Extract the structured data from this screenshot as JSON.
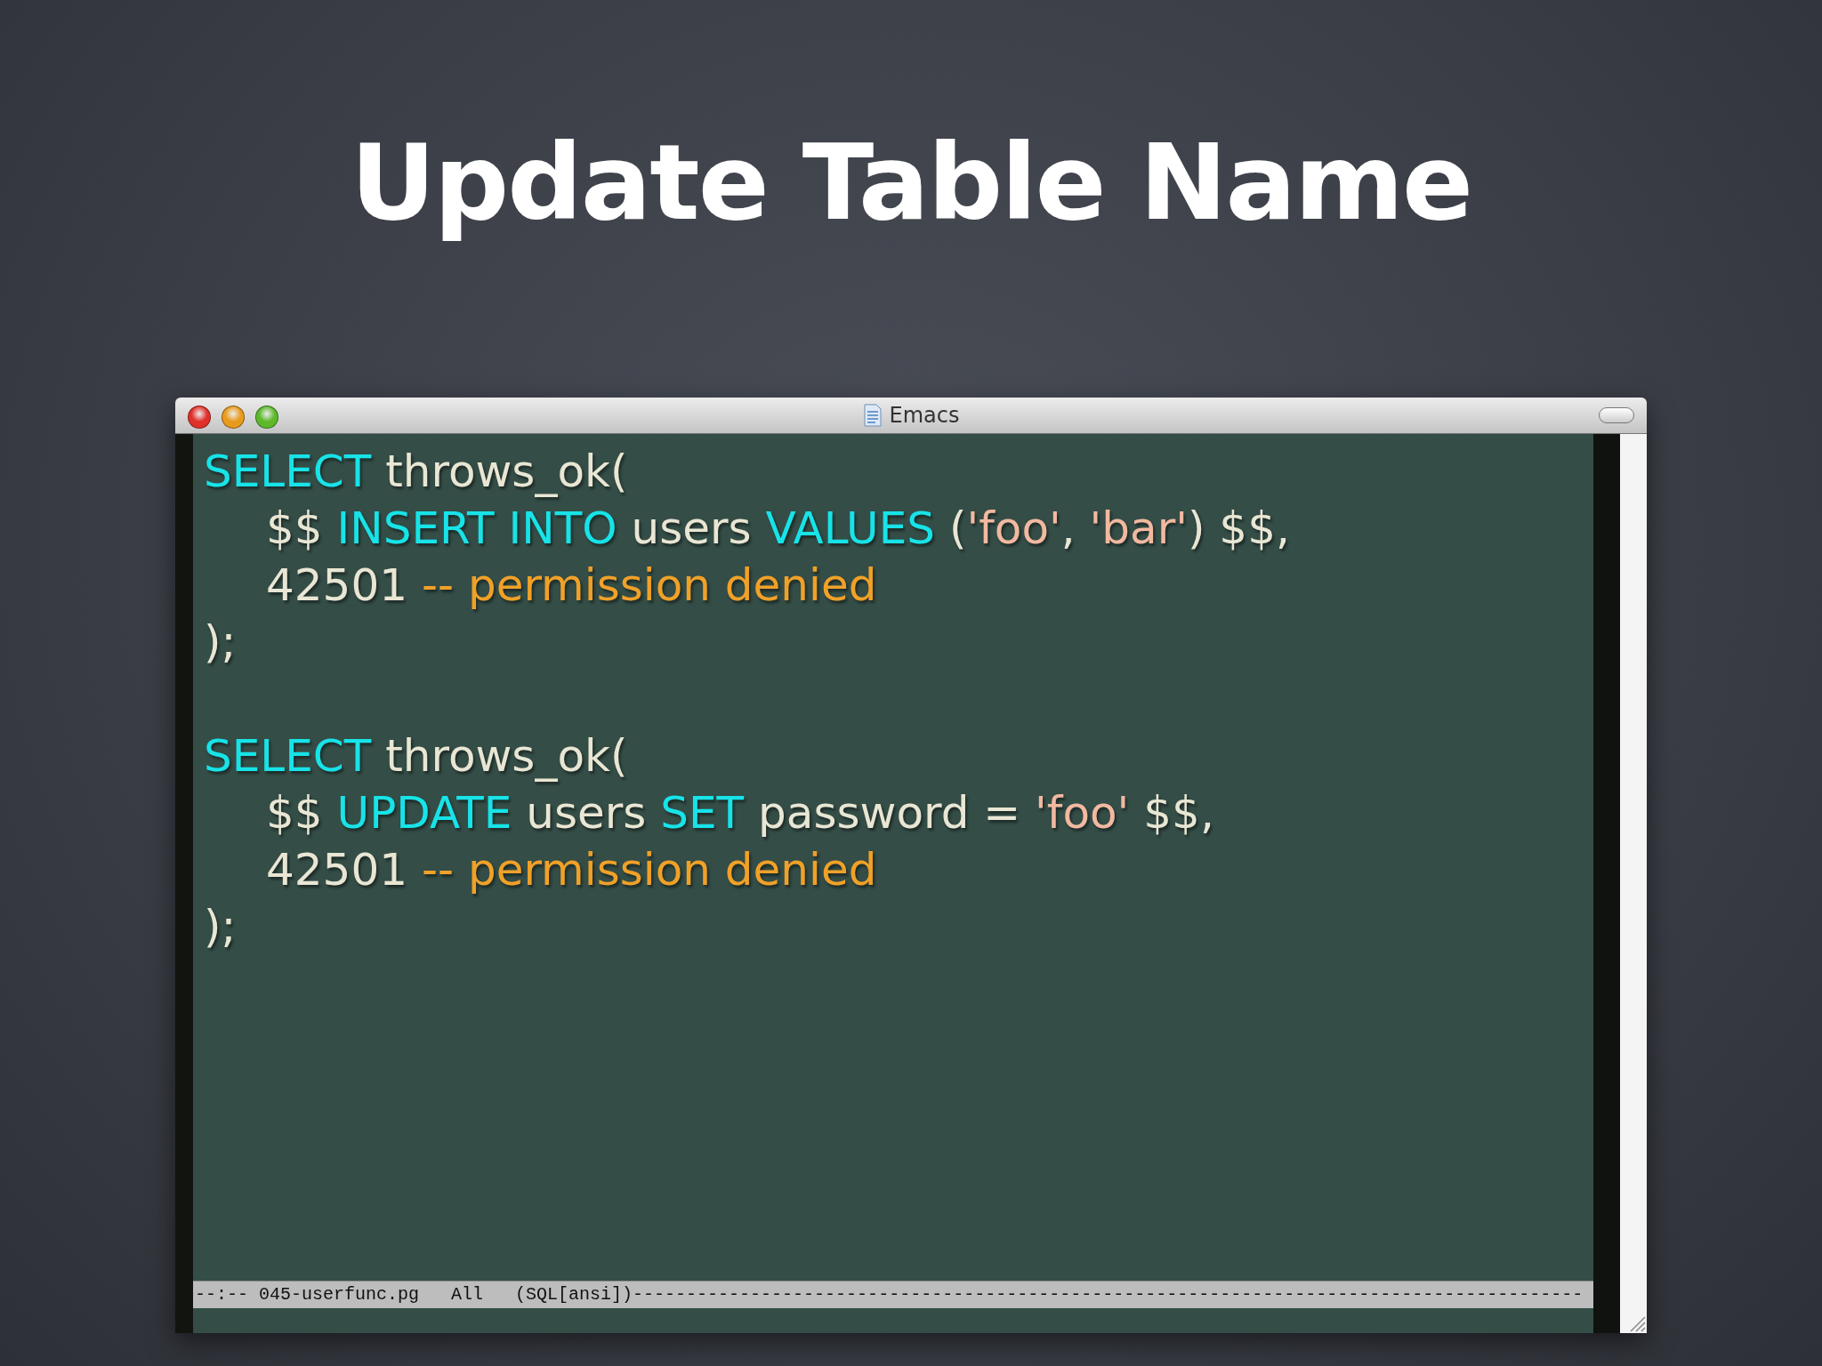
{
  "slide_title": "Update Table Name",
  "window": {
    "title": "Emacs"
  },
  "statements": [
    {
      "lines": [
        {
          "tokens": [
            {
              "kind": "keyword",
              "text": "SELECT"
            },
            {
              "kind": "plain",
              "text": " throws_ok("
            }
          ],
          "children": [
            {
              "tokens": [
                {
                  "kind": "plain",
                  "text": "$$ "
                },
                {
                  "kind": "keyword",
                  "text": "INSERT INTO"
                },
                {
                  "kind": "plain",
                  "text": " users "
                },
                {
                  "kind": "keyword",
                  "text": "VALUES"
                },
                {
                  "kind": "plain",
                  "text": " ("
                },
                {
                  "kind": "string",
                  "text": "'foo'"
                },
                {
                  "kind": "plain",
                  "text": ", "
                },
                {
                  "kind": "string",
                  "text": "'bar'"
                },
                {
                  "kind": "plain",
                  "text": ") $$,"
                }
              ]
            },
            {
              "tokens": [
                {
                  "kind": "plain",
                  "text": "42501 "
                },
                {
                  "kind": "comment",
                  "text": "-- permission denied"
                }
              ]
            }
          ]
        },
        {
          "tokens": [
            {
              "kind": "plain",
              "text": ");"
            }
          ]
        }
      ]
    },
    {
      "lines": [
        {
          "tokens": [
            {
              "kind": "keyword",
              "text": "SELECT"
            },
            {
              "kind": "plain",
              "text": " throws_ok("
            }
          ],
          "children": [
            {
              "tokens": [
                {
                  "kind": "plain",
                  "text": "$$ "
                },
                {
                  "kind": "keyword",
                  "text": "UPDATE"
                },
                {
                  "kind": "plain",
                  "text": " users "
                },
                {
                  "kind": "keyword",
                  "text": "SET"
                },
                {
                  "kind": "plain",
                  "text": " password = "
                },
                {
                  "kind": "string",
                  "text": "'foo'"
                },
                {
                  "kind": "plain",
                  "text": " $$,"
                }
              ]
            },
            {
              "tokens": [
                {
                  "kind": "plain",
                  "text": "42501 "
                },
                {
                  "kind": "comment",
                  "text": "-- permission denied"
                }
              ]
            }
          ]
        },
        {
          "tokens": [
            {
              "kind": "plain",
              "text": ");"
            }
          ]
        }
      ]
    }
  ],
  "mode_line": {
    "text": "--:-- 045-userfunc.pg   All   (SQL[ansi])-----------------------------------------------------------------------------------------"
  }
}
